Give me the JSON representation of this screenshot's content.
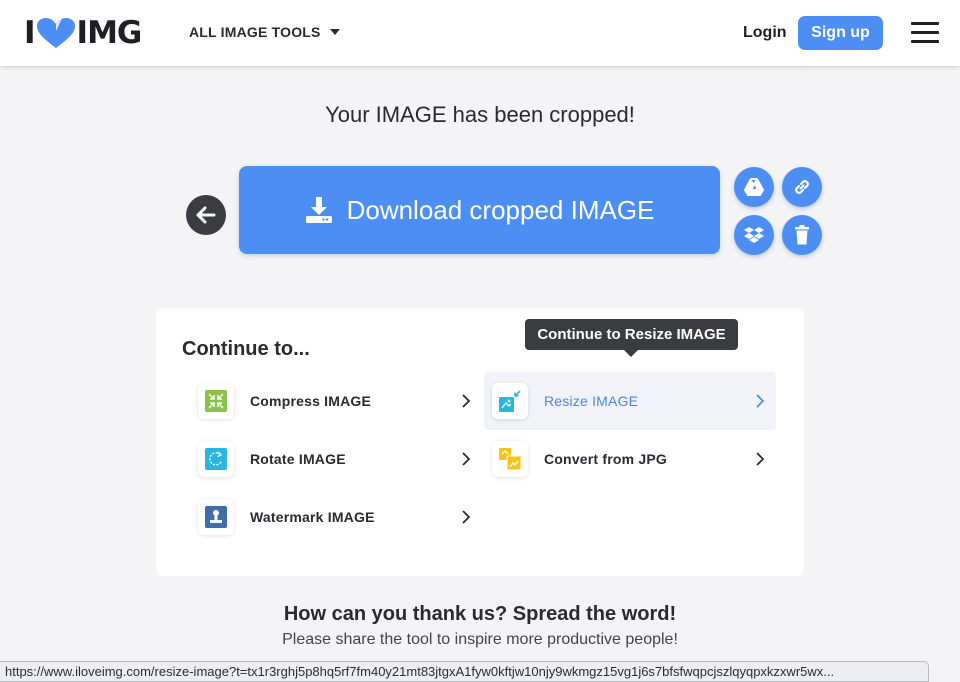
{
  "header": {
    "logo_left": "I",
    "logo_right": "IMG",
    "tools_label": "ALL IMAGE TOOLS",
    "login_label": "Login",
    "signup_label": "Sign up"
  },
  "main": {
    "title": "Your IMAGE has been cropped!",
    "download_label": "Download cropped IMAGE",
    "share_buttons": [
      "google-drive-icon",
      "link-icon",
      "dropbox-icon",
      "trash-icon"
    ]
  },
  "continue": {
    "title": "Continue to...",
    "tooltip": "Continue to Resize IMAGE",
    "items": [
      {
        "label": "Compress IMAGE",
        "icon": "compress-icon",
        "color": "#8bc34a"
      },
      {
        "label": "Rotate IMAGE",
        "icon": "rotate-icon",
        "color": "#29b6e6"
      },
      {
        "label": "Watermark IMAGE",
        "icon": "watermark-icon",
        "color": "#3f6da8"
      },
      {
        "label": "Resize IMAGE",
        "icon": "resize-icon",
        "color": "#29b6e6"
      },
      {
        "label": "Convert from JPG",
        "icon": "convert-icon",
        "color": "#f5c518"
      }
    ]
  },
  "thanks": {
    "title": "How can you thank us? Spread the word!",
    "subtitle": "Please share the tool to inspire more productive people!"
  },
  "status": {
    "url": "https://www.iloveimg.com/resize-image?t=tx1r3rghj5p8hq5rf7fm40y21mt83jtgxA1fyw0kftjw10njy9wkmgz15vg1j6s7bfsfwqpcjszlqyqpxkzxwr5wx..."
  },
  "colors": {
    "accent": "#4d8ef5",
    "dark_button": "#3b3b42",
    "background": "#f4f4f6"
  }
}
